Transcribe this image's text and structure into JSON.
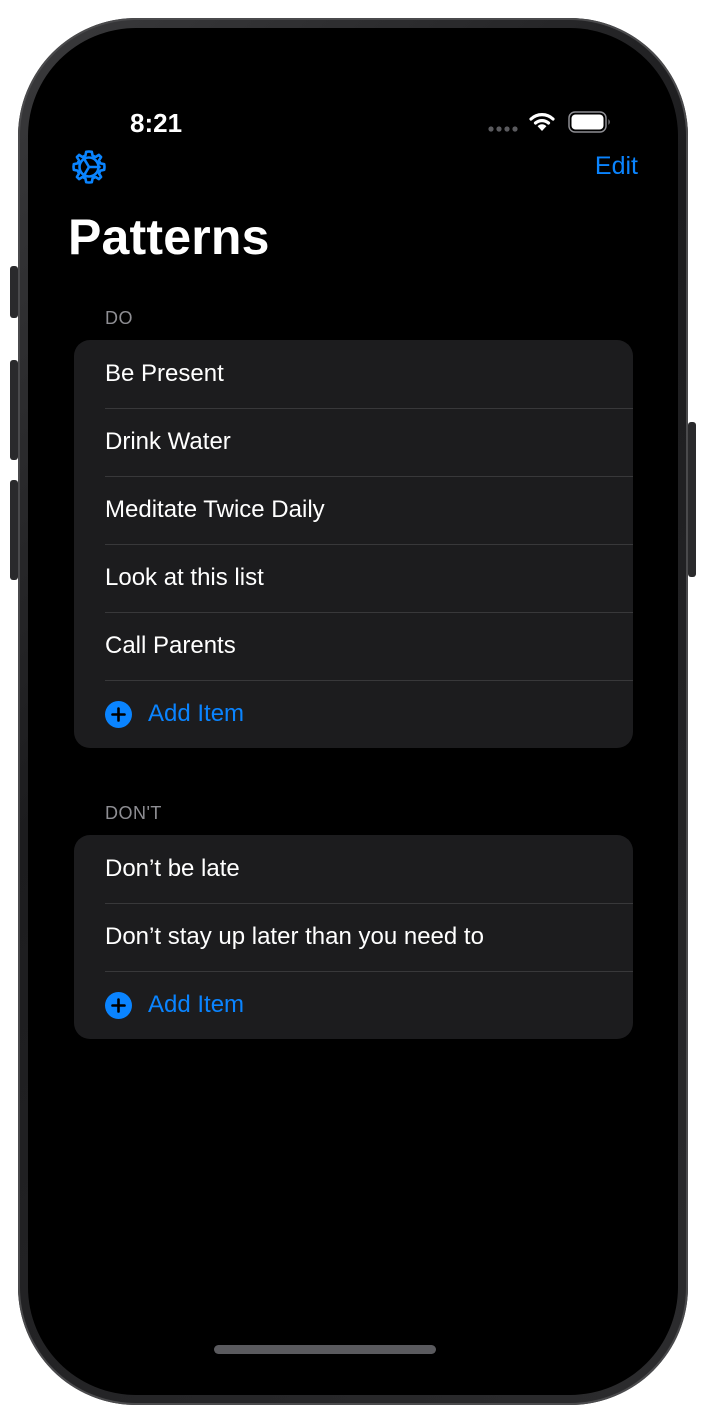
{
  "status": {
    "time": "8:21"
  },
  "nav": {
    "edit_label": "Edit",
    "title": "Patterns",
    "settings_icon": "gear-icon"
  },
  "colors": {
    "accent": "#0a84ff",
    "background": "#000000",
    "cell": "#1c1c1e",
    "secondary_text": "#8e8e93"
  },
  "sections": {
    "do": {
      "header": "DO",
      "items": [
        "Be Present",
        "Drink Water",
        "Meditate Twice Daily",
        "Look at this list",
        "Call Parents"
      ],
      "add_label": "Add Item"
    },
    "dont": {
      "header": "DON'T",
      "items": [
        "Don’t be late",
        "Don’t stay up later than you need to"
      ],
      "add_label": "Add Item"
    }
  }
}
